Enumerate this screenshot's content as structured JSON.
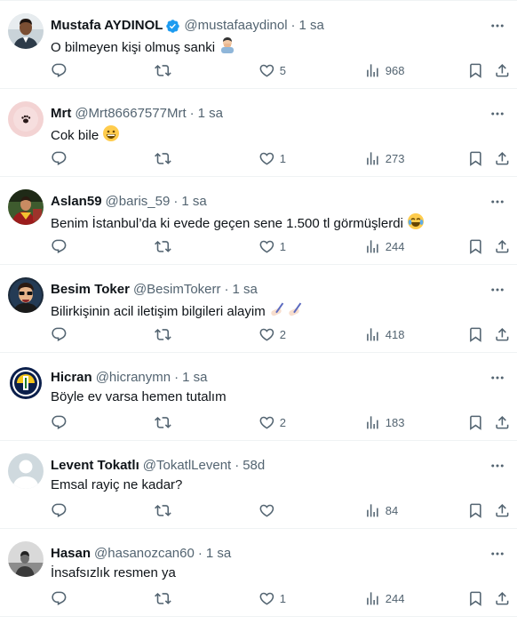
{
  "replies": [
    {
      "name": "Mustafa AYDINOL",
      "verified": true,
      "handle": "@mustafaaydinol",
      "time": "1 sa",
      "text": "O bilmeyen kişi olmuş sanki",
      "emoji": "person-facepalming",
      "replies_count": "",
      "retweets_count": "",
      "likes": "5",
      "views": "968",
      "avatar": "man-in-suit"
    },
    {
      "name": "Mrt",
      "verified": false,
      "handle": "@Mrt86667577Mrt",
      "time": "1 sa",
      "text": "Cok bile",
      "emoji": "grinning-face",
      "replies_count": "",
      "retweets_count": "",
      "likes": "1",
      "views": "273",
      "avatar": "pink-paw"
    },
    {
      "name": "Aslan59",
      "verified": false,
      "handle": "@baris_59",
      "time": "1 sa",
      "text": "Benim İstanbul’da ki evede geçen sene 1.500 tl görmüşlerdi",
      "emoji": "face-with-tears-of-joy",
      "replies_count": "",
      "retweets_count": "",
      "likes": "1",
      "views": "244",
      "avatar": "football-player"
    },
    {
      "name": "Besim Toker",
      "verified": false,
      "handle": "@BesimTokerr",
      "time": "1 sa",
      "text": "Bilirkişinin acil iletişim bilgileri alayim",
      "emoji": "writing-hands",
      "replies_count": "",
      "retweets_count": "",
      "likes": "2",
      "views": "418",
      "avatar": "cartoon-man"
    },
    {
      "name": "Hicran",
      "verified": false,
      "handle": "@hicranymn",
      "time": "1 sa",
      "text": "Böyle ev varsa hemen tutalım",
      "emoji": "",
      "replies_count": "",
      "retweets_count": "",
      "likes": "2",
      "views": "183",
      "avatar": "club-crest"
    },
    {
      "name": "Levent Tokatlı",
      "verified": false,
      "handle": "@TokatlLevent",
      "time": "58d",
      "text": "Emsal rayiç ne kadar?",
      "emoji": "",
      "replies_count": "",
      "retweets_count": "",
      "likes": "",
      "views": "84",
      "avatar": "default-silhouette"
    },
    {
      "name": "Hasan",
      "verified": false,
      "handle": "@hasanozcan60",
      "time": "1 sa",
      "text": "İnsafsızlık resmen ya",
      "emoji": "",
      "replies_count": "",
      "retweets_count": "",
      "likes": "1",
      "views": "244",
      "avatar": "grey-photo"
    }
  ],
  "colors": {
    "text": "#0f1419",
    "secondary": "#536471",
    "verified": "#1d9bf0",
    "divider": "#eff3f4"
  }
}
